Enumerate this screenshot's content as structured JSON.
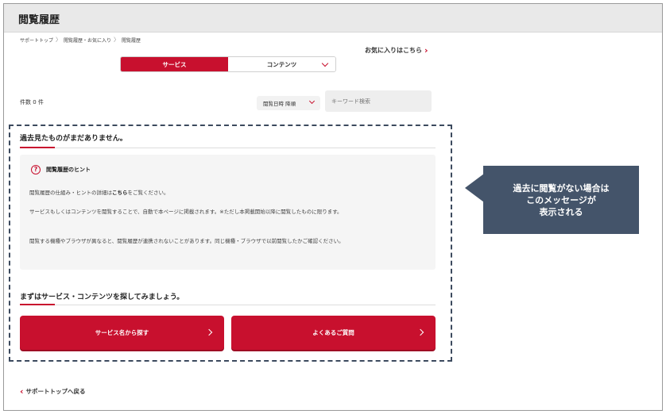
{
  "header": {
    "title": "閲覧履歴"
  },
  "breadcrumb": {
    "items": [
      "サポートトップ",
      "閲覧履歴・お気に入り",
      "閲覧履歴"
    ],
    "separator": "〉"
  },
  "favorites_link": {
    "label": "お気に入りはこちら",
    "icon": "chevron-right-icon"
  },
  "tabs": [
    {
      "label": "サービス",
      "active": true
    },
    {
      "label": "コンテンツ",
      "active": false,
      "icon": "chevron-down-icon"
    }
  ],
  "results": {
    "count_label": "件数 0 件"
  },
  "sort": {
    "selected": "閲覧日時 降順",
    "icon": "chevron-down-icon"
  },
  "search": {
    "placeholder": "キーワード検索",
    "value": ""
  },
  "empty_message": {
    "title": "過去見たものがまだありません。"
  },
  "hint": {
    "icon": "question-circle-icon",
    "icon_glyph": "?",
    "title": "閲覧履歴のヒント",
    "p1_before": "閲覧履歴の仕組み・ヒントの詳細は",
    "p1_link": "こちら",
    "p1_after": "をご覧ください。",
    "p2": "サービスもしくはコンテンツを閲覧することで、自動で本ページに掲載されます。※ただし本掲載開始以降に閲覧したものに限ります。",
    "p3": "閲覧する機種やブラウザが異なると、閲覧履歴が連携されないことがあります。同じ機種・ブラウザで以前閲覧したかご確認ください。"
  },
  "find_section": {
    "title": "まずはサービス・コンテンツを探してみましょう。"
  },
  "buttons": [
    {
      "label": "サービス名から探す",
      "icon": "chevron-right-icon"
    },
    {
      "label": "よくあるご質問",
      "icon": "chevron-right-icon"
    }
  ],
  "back_link": {
    "label": "サポートトップへ戻る",
    "icon": "chevron-left-icon"
  },
  "callout": {
    "lines": [
      "過去に閲覧がない場合は",
      "このメッセージが",
      "表示される"
    ]
  },
  "colors": {
    "accent": "#c8102e",
    "callout_bg": "#44546a",
    "header_bg": "#e9e9e9",
    "dash_border": "#3c4a5e"
  }
}
